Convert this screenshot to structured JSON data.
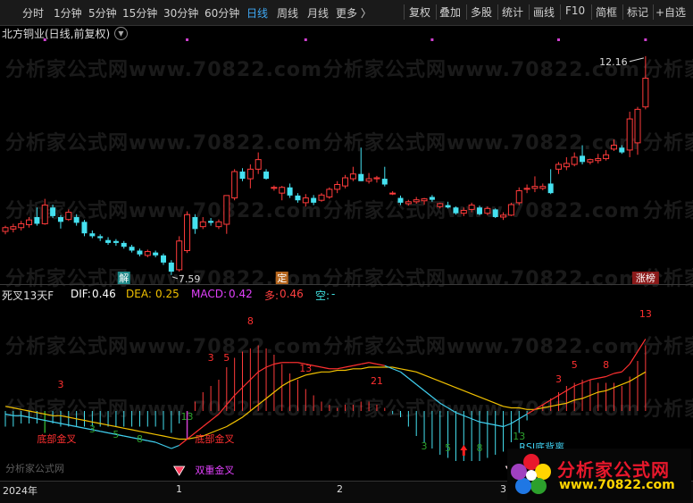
{
  "toolbar": {
    "periods": [
      "分时",
      "1分钟",
      "5分钟",
      "15分钟",
      "30分钟",
      "60分钟",
      "日线",
      "周线",
      "月线",
      "更多 〉"
    ],
    "active_period": "日线",
    "tools": [
      "复权",
      "叠加",
      "多股",
      "统计",
      "画线",
      "F10",
      "简框",
      "标记",
      "+自选"
    ]
  },
  "header": {
    "stock_title": "北方铜业(日线,前复权)"
  },
  "watermark": {
    "text": "分析家公式网www.70822.com"
  },
  "price_chart": {
    "high_label": "12.16",
    "low_label": "7.59",
    "markers": [
      {
        "text": "解",
        "color": "#1f8a8a"
      },
      {
        "text": "定",
        "color": "#b5651d"
      },
      {
        "text": "涨榜",
        "color": "#8b1a1a"
      }
    ]
  },
  "indicator": {
    "name": "死叉13天F",
    "dif_label": "DIF:",
    "dif_value": "0.46",
    "dea_label": "DEA:",
    "dea_value": "0.25",
    "macd_label": "MACD:",
    "macd_value": "0.42",
    "duo_label": "多:",
    "duo_value": "0.46",
    "kong_label": "空:",
    "kong_value": "-",
    "annotations": [
      "底部金叉",
      "底部金叉",
      "双重金叉",
      "RSI底背离"
    ],
    "counts": [
      "3",
      "3",
      "5",
      "8",
      "13",
      "3",
      "5",
      "8",
      "13",
      "21",
      "8",
      "3",
      "5",
      "8",
      "13",
      "3",
      "5",
      "8",
      "13"
    ]
  },
  "axis": {
    "labels": [
      "2024年",
      "1",
      "2",
      "3"
    ]
  },
  "branding": {
    "logo_text": "分析家公式网",
    "logo_url": "www.70822.com",
    "small_text": "分析家公式网"
  },
  "chart_data": {
    "type": "candlestick",
    "title": "北方铜业(日线,前复权)",
    "candles": [
      {
        "o": 8.5,
        "h": 8.62,
        "l": 8.44,
        "c": 8.58
      },
      {
        "o": 8.55,
        "h": 8.66,
        "l": 8.48,
        "c": 8.6
      },
      {
        "o": 8.58,
        "h": 8.72,
        "l": 8.52,
        "c": 8.66
      },
      {
        "o": 8.64,
        "h": 8.8,
        "l": 8.58,
        "c": 8.74
      },
      {
        "o": 8.8,
        "h": 9.0,
        "l": 8.62,
        "c": 8.66
      },
      {
        "o": 8.66,
        "h": 9.18,
        "l": 8.64,
        "c": 9.05
      },
      {
        "o": 9.0,
        "h": 9.06,
        "l": 8.78,
        "c": 8.82
      },
      {
        "o": 8.8,
        "h": 8.84,
        "l": 8.56,
        "c": 8.7
      },
      {
        "o": 8.75,
        "h": 8.96,
        "l": 8.72,
        "c": 8.9
      },
      {
        "o": 8.8,
        "h": 8.86,
        "l": 8.62,
        "c": 8.68
      },
      {
        "o": 8.7,
        "h": 8.74,
        "l": 8.4,
        "c": 8.46
      },
      {
        "o": 8.46,
        "h": 8.52,
        "l": 8.36,
        "c": 8.4
      },
      {
        "o": 8.4,
        "h": 8.44,
        "l": 8.3,
        "c": 8.36
      },
      {
        "o": 8.32,
        "h": 8.38,
        "l": 8.22,
        "c": 8.26
      },
      {
        "o": 8.3,
        "h": 8.34,
        "l": 8.2,
        "c": 8.26
      },
      {
        "o": 8.26,
        "h": 8.3,
        "l": 8.14,
        "c": 8.18
      },
      {
        "o": 8.18,
        "h": 8.22,
        "l": 8.06,
        "c": 8.1
      },
      {
        "o": 8.1,
        "h": 8.14,
        "l": 7.98,
        "c": 8.02
      },
      {
        "o": 8.0,
        "h": 8.12,
        "l": 7.96,
        "c": 8.08
      },
      {
        "o": 8.06,
        "h": 8.1,
        "l": 7.96,
        "c": 8.0
      },
      {
        "o": 8.0,
        "h": 8.04,
        "l": 7.8,
        "c": 7.85
      },
      {
        "o": 7.85,
        "h": 7.9,
        "l": 7.59,
        "c": 7.66
      },
      {
        "o": 7.7,
        "h": 8.4,
        "l": 7.66,
        "c": 8.3
      },
      {
        "o": 8.1,
        "h": 8.92,
        "l": 8.05,
        "c": 8.85
      },
      {
        "o": 8.8,
        "h": 8.86,
        "l": 8.45,
        "c": 8.55
      },
      {
        "o": 8.6,
        "h": 8.8,
        "l": 8.55,
        "c": 8.7
      },
      {
        "o": 8.72,
        "h": 8.78,
        "l": 8.62,
        "c": 8.68
      },
      {
        "o": 8.6,
        "h": 8.75,
        "l": 8.55,
        "c": 8.7
      },
      {
        "o": 8.65,
        "h": 9.25,
        "l": 8.45,
        "c": 9.25
      },
      {
        "o": 9.2,
        "h": 9.8,
        "l": 9.15,
        "c": 9.75
      },
      {
        "o": 9.75,
        "h": 9.82,
        "l": 9.55,
        "c": 9.6
      },
      {
        "o": 9.6,
        "h": 9.9,
        "l": 9.4,
        "c": 9.8
      },
      {
        "o": 9.8,
        "h": 10.15,
        "l": 9.7,
        "c": 10.0
      },
      {
        "o": 9.75,
        "h": 9.8,
        "l": 9.58,
        "c": 9.6
      },
      {
        "o": 9.4,
        "h": 9.46,
        "l": 9.35,
        "c": 9.42
      },
      {
        "o": 9.3,
        "h": 9.45,
        "l": 9.15,
        "c": 9.42
      },
      {
        "o": 9.42,
        "h": 9.5,
        "l": 9.2,
        "c": 9.25
      },
      {
        "o": 9.25,
        "h": 9.3,
        "l": 9.1,
        "c": 9.15
      },
      {
        "o": 9.1,
        "h": 9.28,
        "l": 9.02,
        "c": 9.2
      },
      {
        "o": 9.2,
        "h": 9.26,
        "l": 9.05,
        "c": 9.1
      },
      {
        "o": 9.15,
        "h": 9.3,
        "l": 9.12,
        "c": 9.26
      },
      {
        "o": 9.22,
        "h": 9.42,
        "l": 9.18,
        "c": 9.38
      },
      {
        "o": 9.38,
        "h": 9.55,
        "l": 9.3,
        "c": 9.48
      },
      {
        "o": 9.45,
        "h": 9.68,
        "l": 9.4,
        "c": 9.62
      },
      {
        "o": 9.6,
        "h": 9.85,
        "l": 9.55,
        "c": 9.7
      },
      {
        "o": 9.7,
        "h": 10.25,
        "l": 9.55,
        "c": 9.55
      },
      {
        "o": 9.55,
        "h": 9.72,
        "l": 9.5,
        "c": 9.6
      },
      {
        "o": 9.6,
        "h": 9.66,
        "l": 9.52,
        "c": 9.62
      },
      {
        "o": 9.6,
        "h": 9.85,
        "l": 9.44,
        "c": 9.48
      },
      {
        "o": 9.3,
        "h": 9.34,
        "l": 9.26,
        "c": 9.3
      },
      {
        "o": 9.2,
        "h": 9.25,
        "l": 9.05,
        "c": 9.1
      },
      {
        "o": 9.08,
        "h": 9.16,
        "l": 9.04,
        "c": 9.12
      },
      {
        "o": 9.12,
        "h": 9.22,
        "l": 9.08,
        "c": 9.16
      },
      {
        "o": 9.14,
        "h": 9.2,
        "l": 9.06,
        "c": 9.18
      },
      {
        "o": 9.22,
        "h": 9.26,
        "l": 9.12,
        "c": 9.16
      },
      {
        "o": 9.02,
        "h": 9.1,
        "l": 8.98,
        "c": 9.08
      },
      {
        "o": 9.05,
        "h": 9.12,
        "l": 8.98,
        "c": 9.0
      },
      {
        "o": 9.0,
        "h": 9.02,
        "l": 8.85,
        "c": 8.88
      },
      {
        "o": 8.88,
        "h": 9.0,
        "l": 8.82,
        "c": 8.94
      },
      {
        "o": 8.96,
        "h": 9.1,
        "l": 8.9,
        "c": 9.05
      },
      {
        "o": 9.0,
        "h": 9.04,
        "l": 8.84,
        "c": 8.86
      },
      {
        "o": 8.88,
        "h": 9.02,
        "l": 8.84,
        "c": 8.98
      },
      {
        "o": 8.96,
        "h": 8.98,
        "l": 8.78,
        "c": 8.8
      },
      {
        "o": 8.8,
        "h": 8.9,
        "l": 8.74,
        "c": 8.84
      },
      {
        "o": 8.84,
        "h": 9.1,
        "l": 8.82,
        "c": 9.06
      },
      {
        "o": 9.1,
        "h": 9.42,
        "l": 9.05,
        "c": 9.35
      },
      {
        "o": 9.38,
        "h": 9.48,
        "l": 9.3,
        "c": 9.4
      },
      {
        "o": 9.4,
        "h": 9.65,
        "l": 9.32,
        "c": 9.44
      },
      {
        "o": 9.4,
        "h": 9.5,
        "l": 9.36,
        "c": 9.44
      },
      {
        "o": 9.5,
        "h": 9.8,
        "l": 9.28,
        "c": 9.3
      },
      {
        "o": 9.8,
        "h": 9.95,
        "l": 9.7,
        "c": 9.9
      },
      {
        "o": 9.85,
        "h": 10.05,
        "l": 9.78,
        "c": 9.92
      },
      {
        "o": 9.9,
        "h": 10.15,
        "l": 9.86,
        "c": 10.05
      },
      {
        "o": 10.08,
        "h": 10.3,
        "l": 9.9,
        "c": 9.95
      },
      {
        "o": 9.95,
        "h": 10.02,
        "l": 9.9,
        "c": 10.0
      },
      {
        "o": 9.98,
        "h": 10.12,
        "l": 9.92,
        "c": 10.02
      },
      {
        "o": 10.02,
        "h": 10.2,
        "l": 9.98,
        "c": 10.1
      },
      {
        "o": 10.22,
        "h": 10.42,
        "l": 10.18,
        "c": 10.3
      },
      {
        "o": 10.25,
        "h": 10.3,
        "l": 10.12,
        "c": 10.15
      },
      {
        "o": 10.2,
        "h": 11.0,
        "l": 10.05,
        "c": 10.85
      },
      {
        "o": 10.35,
        "h": 11.1,
        "l": 10.1,
        "c": 11.05
      },
      {
        "o": 11.1,
        "h": 12.16,
        "l": 11.05,
        "c": 11.7
      }
    ],
    "dif": [
      -0.02,
      -0.03,
      -0.03,
      -0.04,
      -0.05,
      -0.06,
      -0.07,
      -0.08,
      -0.09,
      -0.1,
      -0.11,
      -0.12,
      -0.13,
      -0.14,
      -0.15,
      -0.16,
      -0.17,
      -0.18,
      -0.19,
      -0.2,
      -0.22,
      -0.24,
      -0.22,
      -0.18,
      -0.14,
      -0.1,
      -0.06,
      -0.02,
      0.04,
      0.1,
      0.15,
      0.2,
      0.25,
      0.28,
      0.3,
      0.31,
      0.31,
      0.31,
      0.3,
      0.29,
      0.28,
      0.27,
      0.27,
      0.28,
      0.29,
      0.3,
      0.31,
      0.3,
      0.29,
      0.27,
      0.25,
      0.21,
      0.17,
      0.13,
      0.09,
      0.05,
      0.02,
      -0.01,
      -0.03,
      -0.05,
      -0.07,
      -0.08,
      -0.09,
      -0.1,
      -0.08,
      -0.05,
      -0.02,
      0.01,
      0.04,
      0.07,
      0.1,
      0.13,
      0.16,
      0.18,
      0.2,
      0.21,
      0.22,
      0.24,
      0.25,
      0.3,
      0.38,
      0.46
    ],
    "dea": [
      0.03,
      0.02,
      0.01,
      0.0,
      -0.01,
      -0.02,
      -0.03,
      -0.03,
      -0.04,
      -0.05,
      -0.06,
      -0.07,
      -0.08,
      -0.09,
      -0.1,
      -0.11,
      -0.12,
      -0.13,
      -0.14,
      -0.15,
      -0.16,
      -0.17,
      -0.18,
      -0.18,
      -0.17,
      -0.16,
      -0.14,
      -0.12,
      -0.1,
      -0.07,
      -0.04,
      0.0,
      0.04,
      0.08,
      0.12,
      0.16,
      0.19,
      0.21,
      0.23,
      0.24,
      0.25,
      0.25,
      0.26,
      0.26,
      0.27,
      0.27,
      0.28,
      0.28,
      0.28,
      0.28,
      0.27,
      0.26,
      0.25,
      0.23,
      0.21,
      0.19,
      0.17,
      0.15,
      0.13,
      0.11,
      0.09,
      0.07,
      0.05,
      0.03,
      0.02,
      0.02,
      0.01,
      0.01,
      0.02,
      0.03,
      0.04,
      0.05,
      0.07,
      0.08,
      0.1,
      0.12,
      0.13,
      0.15,
      0.17,
      0.19,
      0.22,
      0.25
    ],
    "macd": [
      -0.1,
      -0.1,
      -0.08,
      -0.08,
      -0.08,
      -0.08,
      -0.08,
      -0.1,
      -0.1,
      -0.1,
      -0.1,
      -0.1,
      -0.1,
      -0.1,
      -0.1,
      -0.1,
      -0.1,
      -0.1,
      -0.1,
      -0.1,
      -0.12,
      -0.14,
      -0.08,
      0.0,
      0.06,
      0.12,
      0.16,
      0.2,
      0.28,
      0.34,
      0.38,
      0.4,
      0.42,
      0.4,
      0.36,
      0.3,
      0.24,
      0.2,
      0.14,
      0.1,
      0.06,
      0.04,
      0.02,
      0.04,
      0.04,
      0.06,
      0.06,
      0.04,
      0.02,
      -0.02,
      -0.04,
      -0.1,
      -0.16,
      -0.2,
      -0.24,
      -0.28,
      -0.3,
      -0.32,
      -0.32,
      -0.32,
      -0.32,
      -0.3,
      -0.28,
      -0.26,
      -0.2,
      -0.14,
      -0.06,
      0.0,
      0.04,
      0.08,
      0.12,
      0.16,
      0.18,
      0.2,
      0.2,
      0.18,
      0.18,
      0.18,
      0.16,
      0.22,
      0.32,
      0.42
    ],
    "ylim": [
      7.4,
      12.4
    ]
  }
}
